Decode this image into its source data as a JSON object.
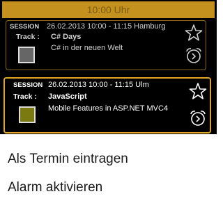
{
  "header": {
    "time": "10:00 Uhr"
  },
  "sessions": [
    {
      "label": "SESSION",
      "datetime_location": "26.02.2013 10:00 - 11:15 Hamburg",
      "track_label": "Track :",
      "track_name": "C# Days",
      "track_description": "C# in der neuen Welt",
      "track_color": "#666666",
      "icons": [
        "star-outline-icon",
        "alarm-clock-icon"
      ],
      "selected": false
    },
    {
      "label": "SESSION",
      "datetime_location": "26.02.2013 10:00 - 11:15 Ulm",
      "track_label": "Track :",
      "track_name": "JavaScript",
      "track_description": "Mobile Features in ASP.NET MVC4",
      "track_color": "#7a7a10",
      "icons": [
        "star-outline-icon",
        "alarm-clock-icon"
      ],
      "selected": true
    }
  ],
  "context_menu": {
    "items": [
      "Als Termin eintragen",
      "Alarm aktivieren"
    ]
  },
  "colors": {
    "accent": "#e0a526",
    "header_bar": "#c4911f",
    "background_top": "#000000",
    "background_menu": "#ffffff"
  }
}
